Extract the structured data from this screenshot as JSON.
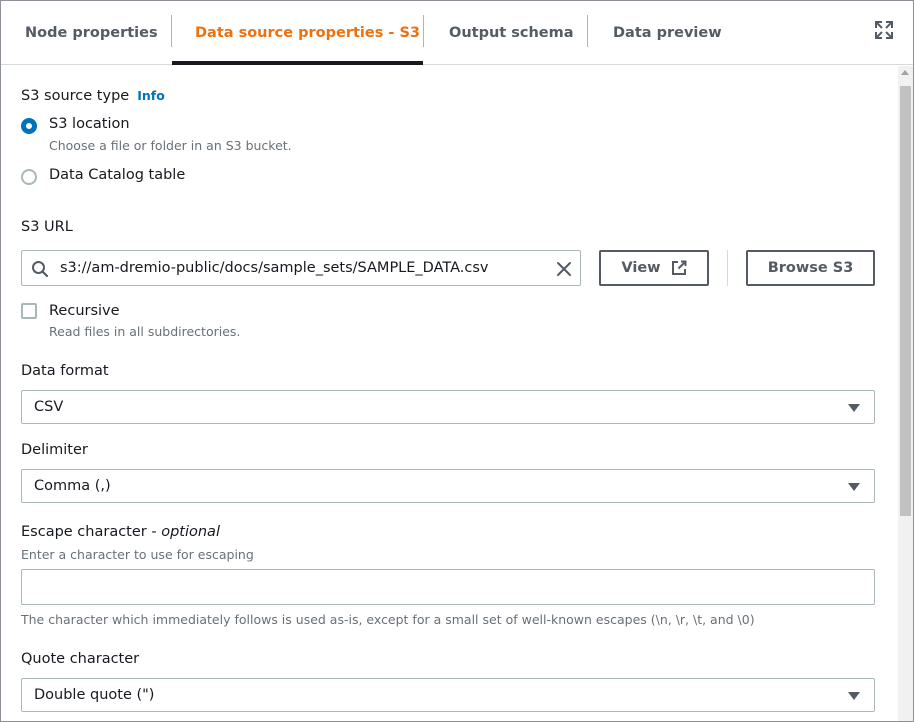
{
  "tabs": [
    {
      "label": "Node properties"
    },
    {
      "label": "Data source properties - S3"
    },
    {
      "label": "Output schema"
    },
    {
      "label": "Data preview"
    }
  ],
  "s3_source_type": {
    "label": "S3 source type",
    "info": "Info",
    "options": [
      {
        "label": "S3 location",
        "description": "Choose a file or folder in an S3 bucket.",
        "selected": true
      },
      {
        "label": "Data Catalog table",
        "selected": false
      }
    ]
  },
  "s3_url": {
    "label": "S3 URL",
    "value": "s3://am-dremio-public/docs/sample_sets/SAMPLE_DATA.csv",
    "view_label": "View",
    "browse_label": "Browse S3"
  },
  "recursive": {
    "label": "Recursive",
    "description": "Read files in all subdirectories.",
    "checked": false
  },
  "data_format": {
    "label": "Data format",
    "value": "CSV"
  },
  "delimiter": {
    "label": "Delimiter",
    "value": "Comma (,)"
  },
  "escape_character": {
    "label": "Escape character - ",
    "optional": "optional",
    "description": "Enter a character to use for escaping",
    "value": "",
    "help": "The character which immediately follows is used as-is, except for a small set of well-known escapes (\\n, \\r, \\t, and \\0)"
  },
  "quote_character": {
    "label": "Quote character",
    "value": "Double quote (\")"
  },
  "colors": {
    "accent": "#ec7211",
    "link": "#0073bb",
    "text": "#16191f",
    "muted": "#687078"
  }
}
